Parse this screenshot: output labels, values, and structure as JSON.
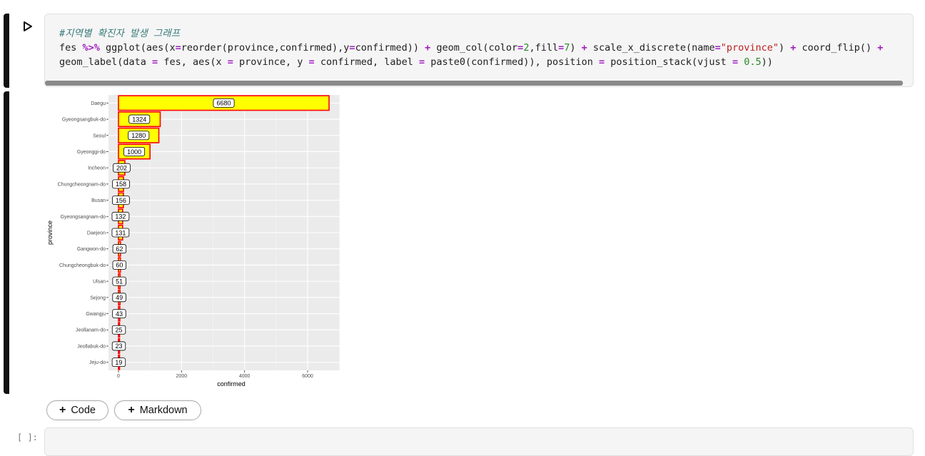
{
  "code_cell": {
    "comment": "#지역별 확진자 발생 그래프",
    "line1": [
      {
        "t": "fes ",
        "c": ""
      },
      {
        "t": "%>%",
        "c": "op"
      },
      {
        "t": " ggplot(aes(x",
        "c": ""
      },
      {
        "t": "=",
        "c": "op"
      },
      {
        "t": "reorder(province,confirmed),y",
        "c": ""
      },
      {
        "t": "=",
        "c": "op"
      },
      {
        "t": "confirmed)) ",
        "c": ""
      },
      {
        "t": "+",
        "c": "op"
      },
      {
        "t": " geom_col(color",
        "c": ""
      },
      {
        "t": "=",
        "c": "op"
      },
      {
        "t": "2",
        "c": "num"
      },
      {
        "t": ",fill",
        "c": ""
      },
      {
        "t": "=",
        "c": "op"
      },
      {
        "t": "7",
        "c": "num"
      },
      {
        "t": ") ",
        "c": ""
      },
      {
        "t": "+",
        "c": "op"
      },
      {
        "t": " scale_x_discrete(name",
        "c": ""
      },
      {
        "t": "=",
        "c": "op"
      },
      {
        "t": "\"province\"",
        "c": "str"
      },
      {
        "t": ") ",
        "c": ""
      },
      {
        "t": "+",
        "c": "op"
      },
      {
        "t": " coord_flip() ",
        "c": ""
      },
      {
        "t": "+",
        "c": "op"
      }
    ],
    "line2": [
      {
        "t": "geom_label(data ",
        "c": ""
      },
      {
        "t": "=",
        "c": "op"
      },
      {
        "t": " fes, aes(x ",
        "c": ""
      },
      {
        "t": "=",
        "c": "op"
      },
      {
        "t": " province, y ",
        "c": ""
      },
      {
        "t": "=",
        "c": "op"
      },
      {
        "t": " confirmed, label ",
        "c": ""
      },
      {
        "t": "=",
        "c": "op"
      },
      {
        "t": " paste0(confirmed)), position ",
        "c": ""
      },
      {
        "t": "=",
        "c": "op"
      },
      {
        "t": " position_stack(vjust ",
        "c": ""
      },
      {
        "t": "=",
        "c": "op"
      },
      {
        "t": " ",
        "c": ""
      },
      {
        "t": "0.5",
        "c": "num"
      },
      {
        "t": "))",
        "c": ""
      }
    ]
  },
  "buttons": {
    "add_code": "Code",
    "add_markdown": "Markdown"
  },
  "empty_prompt": "[ ]:",
  "chart_data": {
    "type": "bar",
    "orientation": "horizontal",
    "xlabel": "confirmed",
    "ylabel": "province",
    "xlim": [
      0,
      7000
    ],
    "x_ticks": [
      0,
      2000,
      4000,
      6000
    ],
    "bar_outline_color": "#ff0000",
    "bar_fill_color": "#ffff00",
    "panel_background": "#ebebeb",
    "categories": [
      "Daegu",
      "Gyeongsangbuk-do",
      "Seoul",
      "Gyeonggi-do",
      "Incheon",
      "Chungcheongnam-do",
      "Busan",
      "Gyeongsangnam-do",
      "Daejeon",
      "Gangwon-do",
      "Chungcheongbuk-do",
      "Ulsan",
      "Sejong",
      "Gwangju",
      "Jeollanam-do",
      "Jeollabuk-do",
      "Jeju-do"
    ],
    "values": [
      6680,
      1324,
      1280,
      1000,
      202,
      158,
      156,
      132,
      131,
      62,
      60,
      51,
      49,
      43,
      25,
      23,
      19
    ],
    "labels": [
      "6680",
      "1324",
      "1280",
      "1000",
      "202",
      "158",
      "156",
      "132",
      "131",
      "62",
      "60",
      "51",
      "49",
      "43",
      "25",
      "23",
      "19"
    ]
  }
}
